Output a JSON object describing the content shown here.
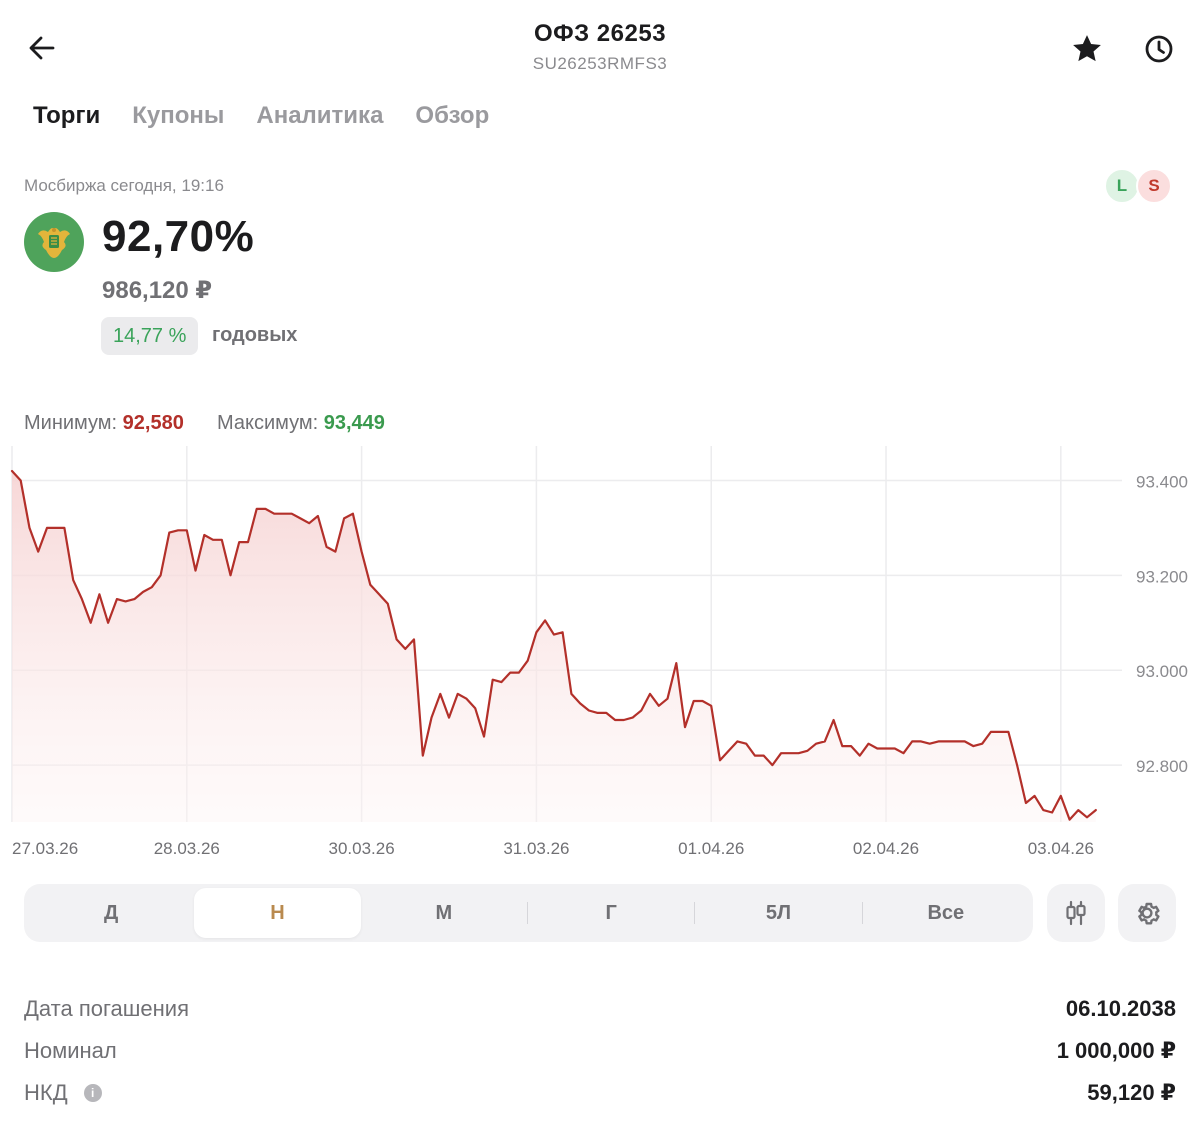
{
  "header": {
    "title": "ОФЗ 26253",
    "subtitle": "SU26253RMFS3"
  },
  "tabs": [
    {
      "label": "Торги",
      "active": true
    },
    {
      "label": "Купоны",
      "active": false
    },
    {
      "label": "Аналитика",
      "active": false
    },
    {
      "label": "Обзор",
      "active": false
    }
  ],
  "quote": {
    "exchange_label": "Мосбиржа сегодня, 19:16",
    "long_badge": "L",
    "short_badge": "S",
    "price_percent": "92,70%",
    "price_rub": "986,120 ₽",
    "yield_value": "14,77 %",
    "yield_label": "годовых"
  },
  "range": {
    "min_label": "Минимум:",
    "min_value": "92,580",
    "max_label": "Максимум:",
    "max_value": "93,449"
  },
  "chart_data": {
    "type": "area",
    "line_color": "#b3302a",
    "fill_color": "#f8dcdc",
    "ylim": [
      92.68,
      93.46
    ],
    "y_ticks": [
      {
        "value": 93.4,
        "label": "93.400"
      },
      {
        "value": 93.2,
        "label": "93.200"
      },
      {
        "value": 93.0,
        "label": "93.000"
      },
      {
        "value": 92.8,
        "label": "92.800"
      }
    ],
    "x_labels": [
      "27.03.26",
      "28.03.26",
      "30.03.26",
      "31.03.26",
      "01.04.26",
      "02.04.26",
      "03.04.26"
    ],
    "x_label_positions": [
      0,
      20,
      40,
      60,
      80,
      100,
      120
    ],
    "xlim": [
      0,
      127
    ],
    "series": [
      {
        "values": [
          93.42,
          93.4,
          93.3,
          93.25,
          93.3,
          93.3,
          93.3,
          93.19,
          93.15,
          93.1,
          93.16,
          93.1,
          93.15,
          93.145,
          93.15,
          93.165,
          93.175,
          93.2,
          93.29,
          93.295,
          93.295,
          93.21,
          93.285,
          93.275,
          93.275,
          93.2,
          93.27,
          93.27,
          93.34,
          93.34,
          93.33,
          93.33,
          93.33,
          93.32,
          93.31,
          93.325,
          93.26,
          93.25,
          93.32,
          93.33,
          93.25,
          93.18,
          93.16,
          93.14,
          93.065,
          93.045,
          93.065,
          92.82,
          92.9,
          92.95,
          92.9,
          92.95,
          92.94,
          92.92,
          92.86,
          92.98,
          92.975,
          92.995,
          92.995,
          93.02,
          93.08,
          93.105,
          93.075,
          93.08,
          92.95,
          92.93,
          92.915,
          92.91,
          92.91,
          92.895,
          92.895,
          92.9,
          92.915,
          92.95,
          92.925,
          92.94,
          93.015,
          92.88,
          92.935,
          92.935,
          92.925,
          92.81,
          92.83,
          92.85,
          92.845,
          92.82,
          92.82,
          92.8,
          92.825,
          92.825,
          92.825,
          92.83,
          92.845,
          92.85,
          92.895,
          92.84,
          92.84,
          92.82,
          92.845,
          92.835,
          92.835,
          92.835,
          92.825,
          92.85,
          92.85,
          92.845,
          92.85,
          92.85,
          92.85,
          92.85,
          92.84,
          92.845,
          92.87,
          92.87,
          92.87,
          92.8,
          92.72,
          92.735,
          92.705,
          92.7,
          92.735,
          92.685,
          92.705,
          92.69,
          92.705
        ]
      }
    ],
    "grid": true
  },
  "periods": [
    {
      "label": "Д",
      "active": false
    },
    {
      "label": "Н",
      "active": true
    },
    {
      "label": "М",
      "active": false
    },
    {
      "label": "Г",
      "active": false
    },
    {
      "label": "5Л",
      "active": false
    },
    {
      "label": "Все",
      "active": false
    }
  ],
  "details": [
    {
      "key": "Дата погашения",
      "value": "06.10.2038",
      "info": false
    },
    {
      "key": "Номинал",
      "value": "1 000,000 ₽",
      "info": false
    },
    {
      "key": "НКД",
      "value": "59,120 ₽",
      "info": true,
      "info_glyph": "i"
    }
  ]
}
